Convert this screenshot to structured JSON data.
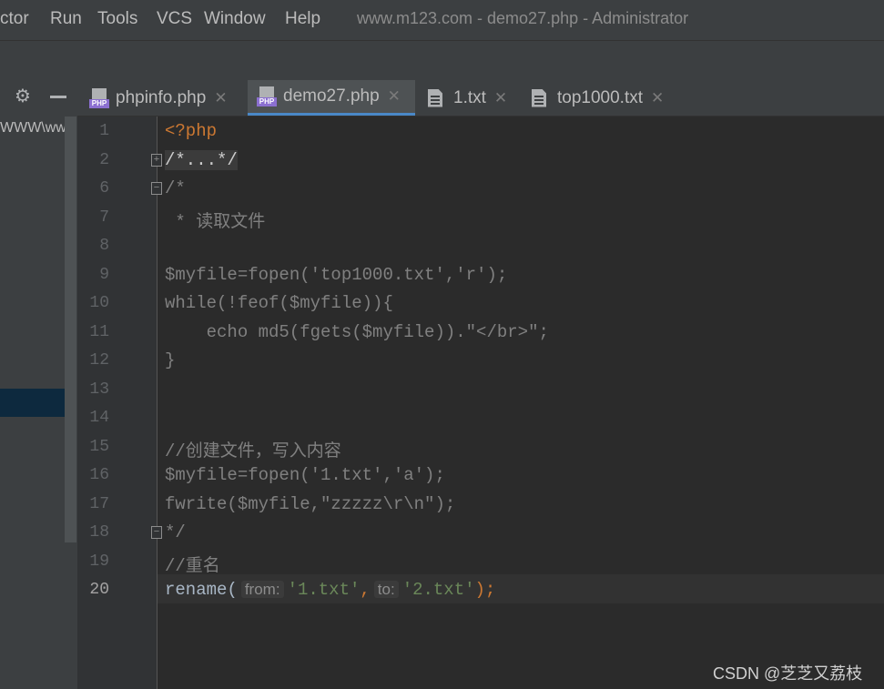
{
  "menubar": {
    "items": [
      "ctor",
      "Run",
      "Tools",
      "VCS",
      "Window",
      "Help"
    ],
    "window_title": "www.m123.com - demo27.php - Administrator"
  },
  "project_panel": {
    "path_text": "WWW\\www"
  },
  "tabs": [
    {
      "label": "phpinfo.php",
      "icon": "php-file-icon",
      "active": false
    },
    {
      "label": "demo27.php",
      "icon": "php-file-icon",
      "active": true
    },
    {
      "label": "1.txt",
      "icon": "text-file-icon",
      "active": false
    },
    {
      "label": "top1000.txt",
      "icon": "text-file-icon",
      "active": false
    }
  ],
  "editor": {
    "line_numbers": [
      "1",
      "2",
      "6",
      "7",
      "8",
      "9",
      "10",
      "11",
      "12",
      "13",
      "14",
      "15",
      "16",
      "17",
      "18",
      "19",
      "20"
    ],
    "current_line": "20",
    "lines": [
      "<?php",
      "/*...*/",
      "/*",
      " * 读取文件",
      "",
      "$myfile=fopen('top1000.txt','r');",
      "while(!feof($myfile)){",
      "    echo md5(fgets($myfile)).\"</br>\";",
      "}",
      "",
      "",
      "//创建文件，写入内容",
      "$myfile=fopen('1.txt','a');",
      "fwrite($myfile,\"zzzzz\\r\\n\");",
      "*/",
      "//重名",
      "rename( from: '1.txt', to: '2.txt');"
    ],
    "rename_call": {
      "fn": "rename(",
      "hint_from": "from:",
      "arg1": "'1.txt'",
      "comma": ",",
      "hint_to": "to:",
      "arg2": "'2.txt'",
      "close": ");"
    }
  },
  "watermark": "CSDN @芝芝又荔枝",
  "colors": {
    "accent": "#4a88c7",
    "keyword": "#cc7832",
    "string": "#6a8759",
    "comment": "#808080"
  }
}
